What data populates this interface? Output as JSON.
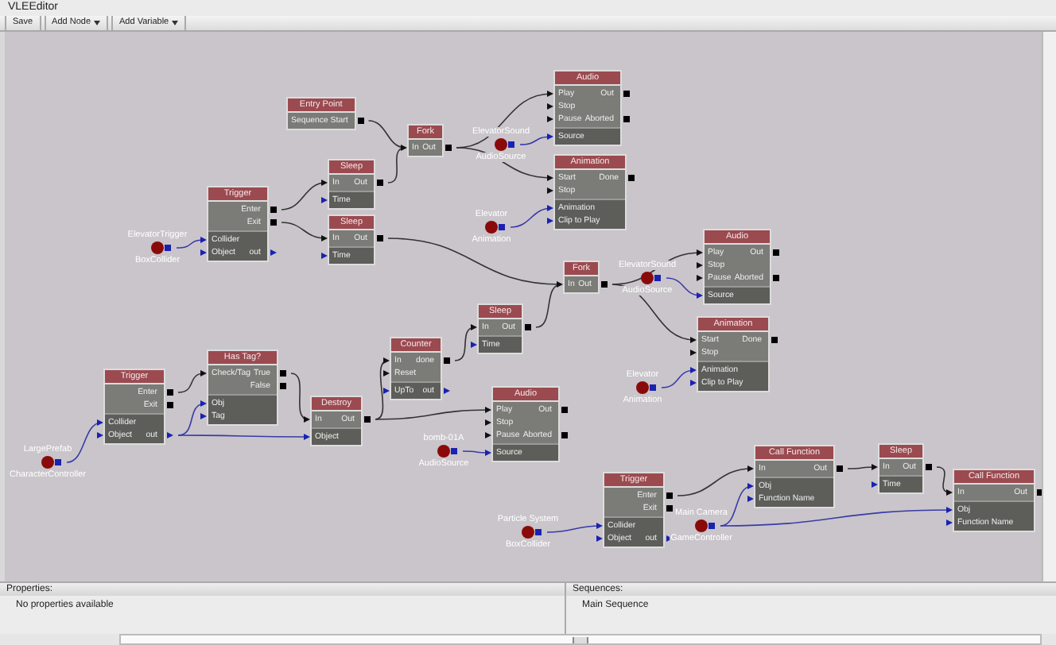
{
  "window": {
    "title": "VLEEditor"
  },
  "toolbar": [
    {
      "label": "Save",
      "kind": "button"
    },
    {
      "label": "Add Node",
      "kind": "dropdown"
    },
    {
      "label": "Add Variable",
      "kind": "dropdown"
    }
  ],
  "nodes": [
    {
      "title": "Trigger",
      "flow_rows": [
        [
          "",
          "Enter"
        ],
        [
          "",
          "Exit"
        ]
      ],
      "var_rows": [
        [
          "Collider",
          ""
        ],
        [
          "Object",
          "out"
        ]
      ]
    },
    {
      "title": "Entry Point",
      "flow_rows": [
        [
          "",
          "Sequence Start"
        ]
      ]
    },
    {
      "title": "Sleep",
      "flow_rows": [
        [
          "In",
          "Out"
        ]
      ],
      "var_rows": [
        [
          "Time",
          ""
        ]
      ]
    },
    {
      "title": "Sleep",
      "flow_rows": [
        [
          "In",
          "Out"
        ]
      ],
      "var_rows": [
        [
          "Time",
          ""
        ]
      ]
    },
    {
      "title": "Fork",
      "flow_rows": [
        [
          "In",
          "Out"
        ]
      ]
    },
    {
      "title": "Audio",
      "flow_rows": [
        [
          "Play",
          "Out"
        ],
        [
          "Stop",
          ""
        ],
        [
          "Pause",
          "Aborted"
        ]
      ],
      "var_rows": [
        [
          "Source",
          ""
        ]
      ]
    },
    {
      "title": "Animation",
      "flow_rows": [
        [
          "Start",
          "Done"
        ],
        [
          "Stop",
          ""
        ]
      ],
      "var_rows": [
        [
          "Animation",
          ""
        ],
        [
          "Clip to Play",
          ""
        ]
      ]
    },
    {
      "title": "Fork",
      "flow_rows": [
        [
          "In",
          "Out"
        ]
      ]
    },
    {
      "title": "Audio",
      "flow_rows": [
        [
          "Play",
          "Out"
        ],
        [
          "Stop",
          ""
        ],
        [
          "Pause",
          "Aborted"
        ]
      ],
      "var_rows": [
        [
          "Source",
          ""
        ]
      ]
    },
    {
      "title": "Trigger",
      "flow_rows": [
        [
          "",
          "Enter"
        ],
        [
          "",
          "Exit"
        ]
      ],
      "var_rows": [
        [
          "Collider",
          ""
        ],
        [
          "Object",
          "out"
        ]
      ]
    },
    {
      "title": "Has Tag?",
      "flow_rows": [
        [
          "Check/Tag",
          "True"
        ],
        [
          "",
          "False"
        ]
      ],
      "var_rows": [
        [
          "Obj",
          ""
        ],
        [
          "Tag",
          ""
        ]
      ]
    },
    {
      "title": "Destroy",
      "flow_rows": [
        [
          "In",
          "Out"
        ]
      ],
      "var_rows": [
        [
          "Object",
          ""
        ]
      ]
    },
    {
      "title": "Counter",
      "flow_rows": [
        [
          "In",
          "done"
        ],
        [
          "Reset",
          ""
        ]
      ],
      "var_rows": [
        [
          "UpTo",
          "out"
        ]
      ]
    },
    {
      "title": "Sleep",
      "flow_rows": [
        [
          "In",
          "Out"
        ]
      ],
      "var_rows": [
        [
          "Time",
          ""
        ]
      ]
    },
    {
      "title": "Audio",
      "flow_rows": [
        [
          "Play",
          "Out"
        ],
        [
          "Stop",
          ""
        ],
        [
          "Pause",
          "Aborted"
        ]
      ],
      "var_rows": [
        [
          "Source",
          ""
        ]
      ]
    },
    {
      "title": "Animation",
      "flow_rows": [
        [
          "Start",
          "Done"
        ],
        [
          "Stop",
          ""
        ]
      ],
      "var_rows": [
        [
          "Animation",
          ""
        ],
        [
          "Clip to Play",
          ""
        ]
      ]
    },
    {
      "title": "Trigger",
      "flow_rows": [
        [
          "",
          "Enter"
        ],
        [
          "",
          "Exit"
        ]
      ],
      "var_rows": [
        [
          "Collider",
          ""
        ],
        [
          "Object",
          "out"
        ]
      ]
    },
    {
      "title": "Call Function",
      "flow_rows": [
        [
          "In",
          "Out"
        ]
      ],
      "var_rows": [
        [
          "Obj",
          ""
        ],
        [
          "Function Name",
          ""
        ]
      ]
    },
    {
      "title": "Sleep",
      "flow_rows": [
        [
          "In",
          "Out"
        ]
      ],
      "var_rows": [
        [
          "Time",
          ""
        ]
      ]
    },
    {
      "title": "Call Function",
      "flow_rows": [
        [
          "In",
          "Out"
        ]
      ],
      "var_rows": [
        [
          "Obj",
          ""
        ],
        [
          "Function Name",
          ""
        ]
      ]
    }
  ],
  "variables": [
    {
      "name": "ElevatorSound",
      "type": "AudioSource"
    },
    {
      "name": "ElevatorTrigger",
      "type": "BoxCollider"
    },
    {
      "name": "Elevator",
      "type": "Animation"
    },
    {
      "name": "ElevatorSound",
      "type": "AudioSource"
    },
    {
      "name": "Elevator",
      "type": "Animation"
    },
    {
      "name": "LargePrefab",
      "type": "CharacterController"
    },
    {
      "name": "bomb-01A",
      "type": "AudioSource"
    },
    {
      "name": "Particle System",
      "type": "BoxCollider"
    },
    {
      "name": "Main Camera",
      "type": "GameController"
    }
  ],
  "properties": {
    "header": "Properties:",
    "text": "No properties available"
  },
  "sequences": {
    "header": "Sequences:",
    "items": [
      "Main Sequence"
    ]
  }
}
